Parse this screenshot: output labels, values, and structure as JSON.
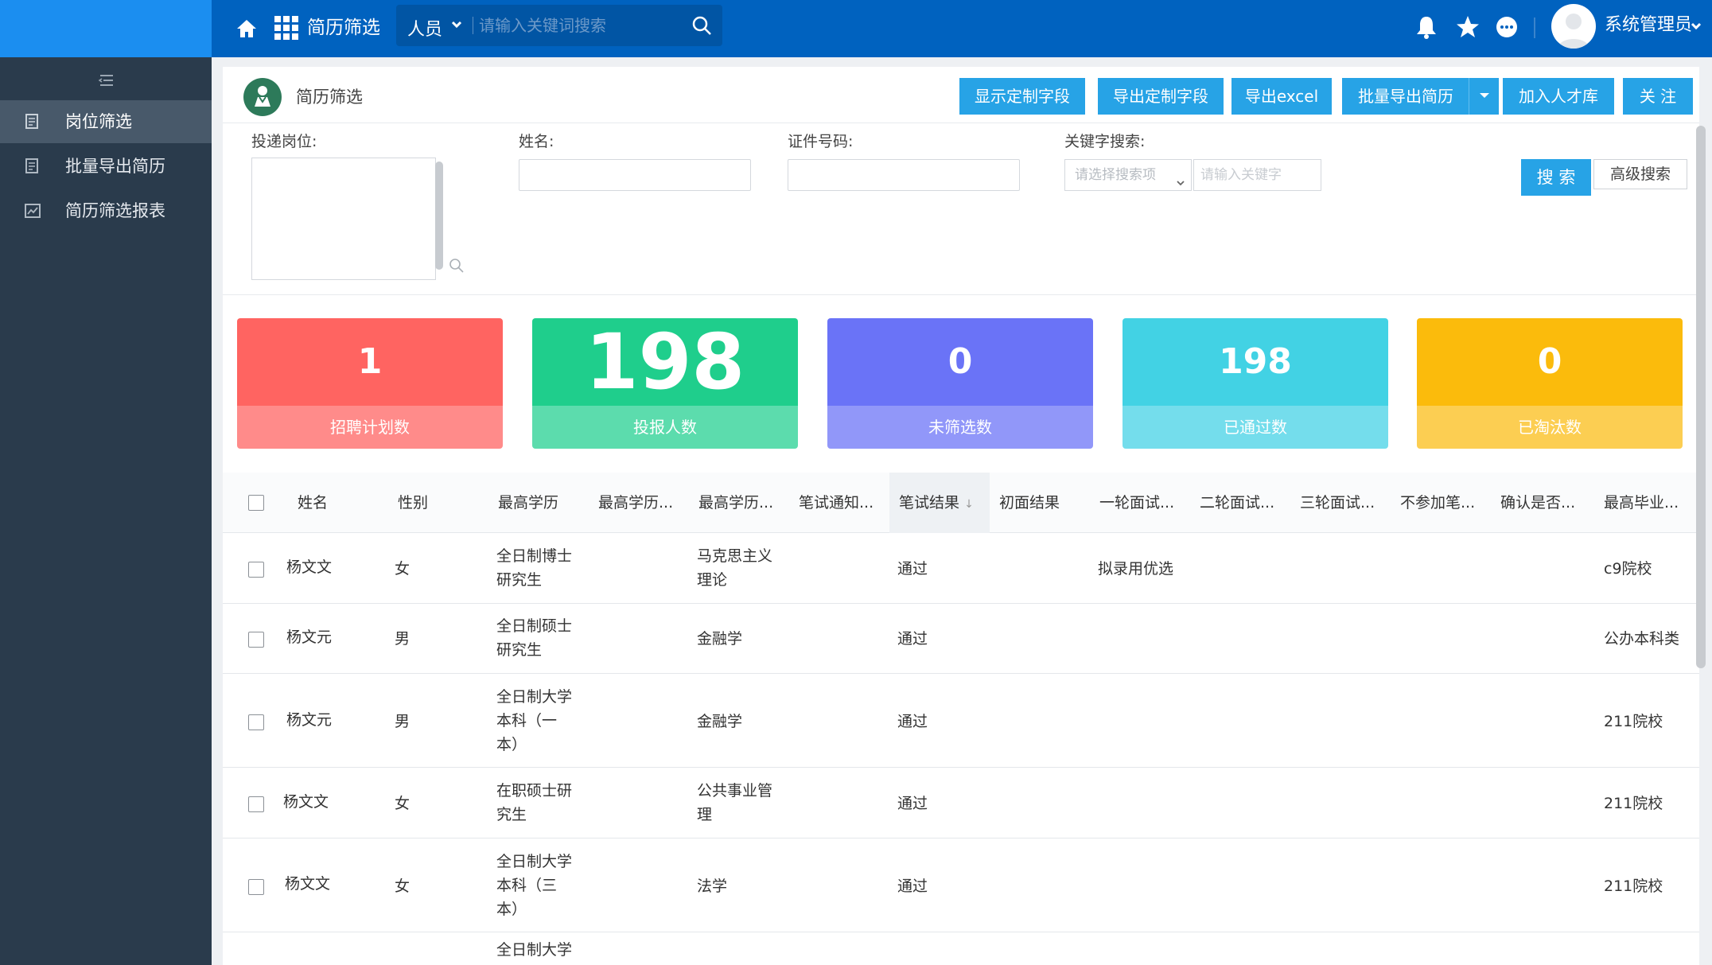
{
  "topbar": {
    "module": "简历筛选",
    "search_scope": "人员",
    "search_placeholder": "请输入关键词搜索",
    "user_name": "系统管理员"
  },
  "sidebar": {
    "items": [
      {
        "label": "岗位筛选",
        "active": true
      },
      {
        "label": "批量导出简历",
        "active": false
      },
      {
        "label": "简历筛选报表",
        "active": false
      }
    ]
  },
  "page": {
    "title": "简历筛选",
    "toolbar": [
      "显示定制字段",
      "导出定制字段",
      "导出excel",
      "批量导出简历",
      "加入人才库",
      "关 注"
    ]
  },
  "filters": {
    "position_label": "投递岗位:",
    "name_label": "姓名:",
    "id_label": "证件号码:",
    "keyword_label": "关键字搜索:",
    "keyword_select_placeholder": "请选择搜索项",
    "keyword_input_placeholder": "请输入关键字",
    "search_button": "搜 索",
    "advanced_button": "高级搜索"
  },
  "stats": [
    {
      "value": "1",
      "label": "招聘计划数",
      "color": "#ff6461"
    },
    {
      "value": "198",
      "label": "投报人数",
      "color": "#1fce8c"
    },
    {
      "value": "0",
      "label": "未筛选数",
      "color": "#6a73f7"
    },
    {
      "value": "198",
      "label": "已通过数",
      "color": "#42d2e4"
    },
    {
      "value": "0",
      "label": "已淘汰数",
      "color": "#fbbb0c"
    }
  ],
  "table": {
    "columns": [
      "姓名",
      "性别",
      "最高学历",
      "最高学历...",
      "最高学历...",
      "笔试通知...",
      "笔试结果",
      "初面结果",
      "一轮面试...",
      "二轮面试...",
      "三轮面试...",
      "不参加笔...",
      "确认是否...",
      "最高毕业..."
    ],
    "rows": [
      {
        "name": "杨文文",
        "gender": "女",
        "education": [
          "全日制博士",
          "研究生"
        ],
        "major": [
          "马克思主义",
          "理论"
        ],
        "exam": "通过",
        "round1": "拟录用优选",
        "school": "c9院校"
      },
      {
        "name": "杨文元",
        "gender": "男",
        "education": [
          "全日制硕士",
          "研究生"
        ],
        "major": [
          "金融学"
        ],
        "exam": "通过",
        "round1": "",
        "school": "公办本科类"
      },
      {
        "name": "杨文元",
        "gender": "男",
        "education": [
          "全日制大学",
          "本科（一",
          "本）"
        ],
        "major": [
          "金融学"
        ],
        "exam": "通过",
        "round1": "",
        "school": "211院校"
      },
      {
        "name": "杨文文",
        "gender": "女",
        "education": [
          "在职硕士研",
          "究生"
        ],
        "major": [
          "公共事业管",
          "理"
        ],
        "exam": "通过",
        "round1": "",
        "school": "211院校"
      },
      {
        "name": "杨文文",
        "gender": "女",
        "education": [
          "全日制大学",
          "本科（三",
          "本）"
        ],
        "major": [
          "法学"
        ],
        "exam": "通过",
        "round1": "",
        "school": "211院校"
      },
      {
        "name": "",
        "gender": "",
        "education": [
          "全日制大学"
        ],
        "major": [],
        "exam": "",
        "round1": "",
        "school": ""
      }
    ]
  }
}
